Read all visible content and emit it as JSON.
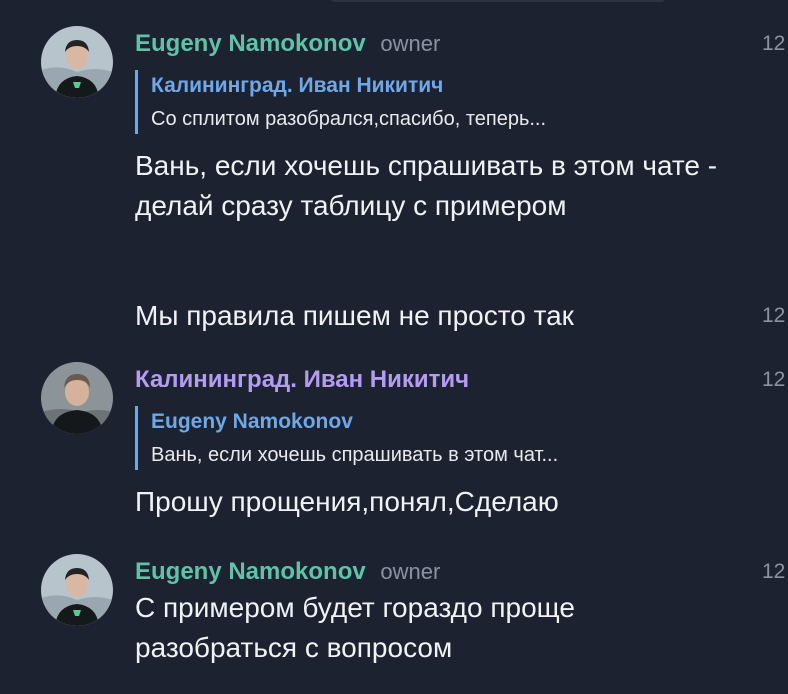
{
  "messages": [
    {
      "sender": "Eugeny Namokonov",
      "role": "owner",
      "time": "12",
      "reply": {
        "name": "Калининград. Иван Никитич",
        "text": "Со сплитом разобрался,спасибо, теперь..."
      },
      "text": "Вань, если хочешь спрашивать в этом чате - делай сразу таблицу с примером"
    },
    {
      "text": "Мы правила пишем не просто так",
      "time": "12"
    },
    {
      "sender": "Калининград. Иван Никитич",
      "time": "12",
      "reply": {
        "name": "Eugeny Namokonov",
        "text": "Вань, если хочешь спрашивать в этом чат..."
      },
      "text": "Прошу прощения,понял,Сделаю"
    },
    {
      "sender": "Eugeny Namokonov",
      "role": "owner",
      "time": "12",
      "text": "С примером будет гораздо проще разобраться с вопросом"
    }
  ],
  "colors": {
    "background": "#1c2230",
    "owner_name": "#5fc3a7",
    "member_name": "#b49cf0",
    "reply_accent": "#6ea8e8"
  }
}
